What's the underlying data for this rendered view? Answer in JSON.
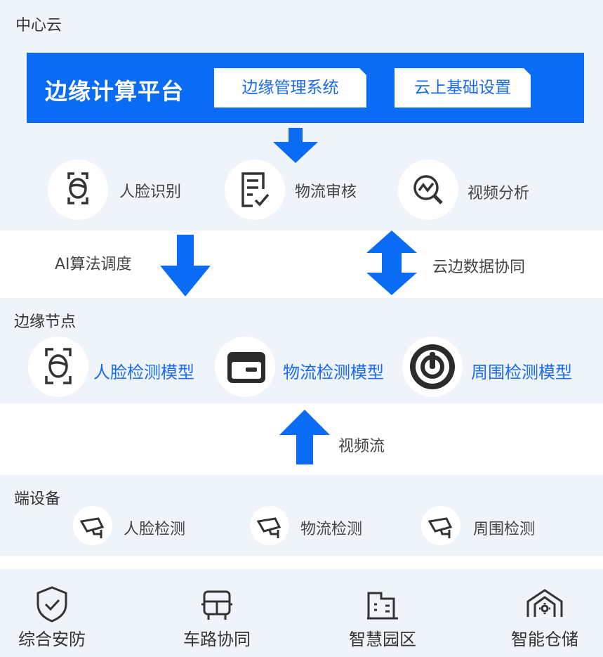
{
  "central_cloud": {
    "title": "中心云",
    "platform_title": "边缘计算平台",
    "buttons": [
      "边缘管理系统",
      "云上基础设置"
    ],
    "services": [
      {
        "icon": "face-recognition-icon",
        "label": "人脸识别"
      },
      {
        "icon": "document-review-icon",
        "label": "物流审核"
      },
      {
        "icon": "analytics-magnifier-icon",
        "label": "视频分析"
      }
    ]
  },
  "connectors_upper": {
    "left_label": "AI算法调度",
    "right_label": "云边数据协同"
  },
  "edge_node": {
    "title": "边缘节点",
    "models": [
      {
        "icon": "face-recognition-icon",
        "label": "人脸检测模型"
      },
      {
        "icon": "wallet-card-icon",
        "label": "物流检测模型"
      },
      {
        "icon": "perimeter-target-icon",
        "label": "周围检测模型"
      }
    ]
  },
  "connectors_lower": {
    "label": "视频流"
  },
  "end_device": {
    "title": "端设备",
    "devices": [
      {
        "icon": "surveillance-camera-icon",
        "label": "人脸检测"
      },
      {
        "icon": "surveillance-camera-icon",
        "label": "物流检测"
      },
      {
        "icon": "surveillance-camera-icon",
        "label": "周围检测"
      }
    ]
  },
  "scenarios": [
    {
      "icon": "shield-check-icon",
      "label": "综合安防"
    },
    {
      "icon": "bus-icon",
      "label": "车路协同"
    },
    {
      "icon": "buildings-icon",
      "label": "智慧园区"
    },
    {
      "icon": "warehouse-gear-icon",
      "label": "智能仓储"
    }
  ],
  "colors": {
    "panel_bg": "#eff4fb",
    "accent_blue": "#0a6bf5",
    "model_text_blue": "#1a6bf3",
    "text_dark": "#333333"
  }
}
